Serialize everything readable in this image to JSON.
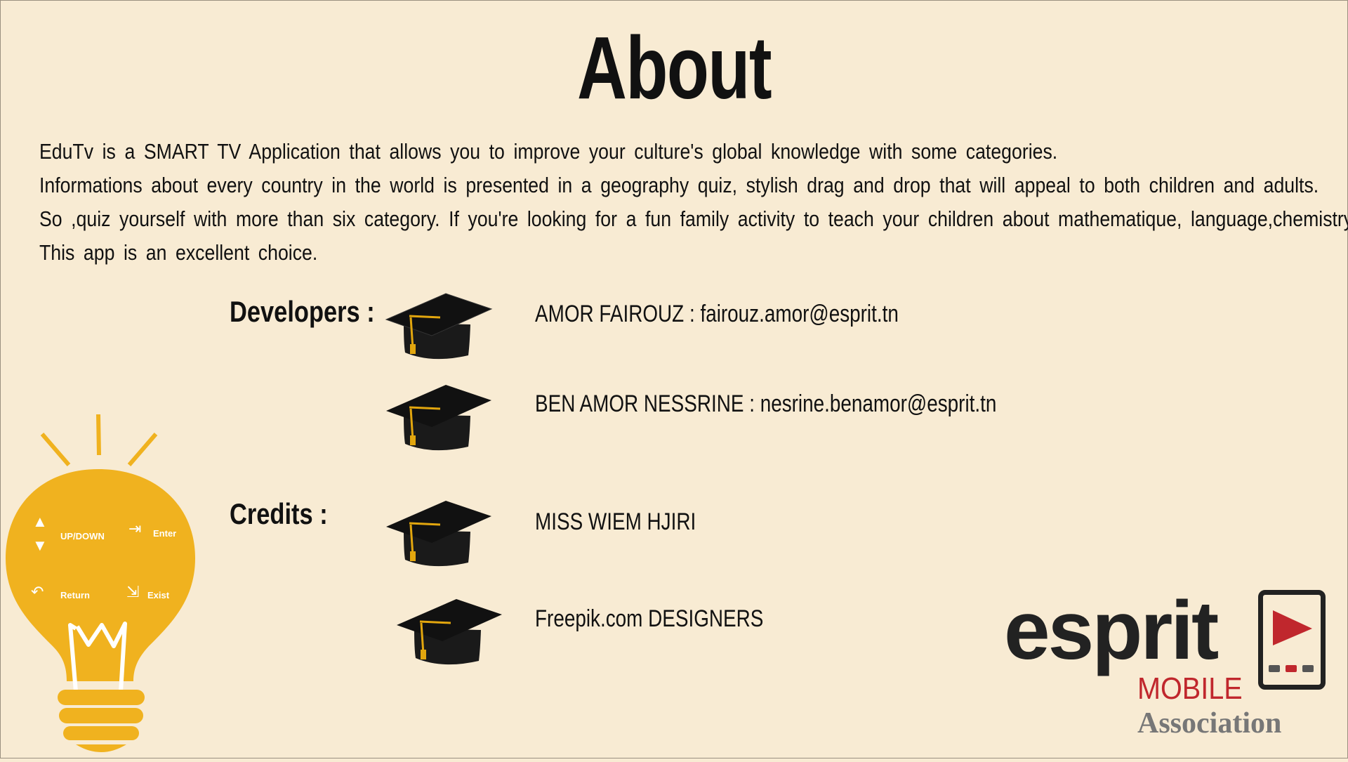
{
  "page": {
    "title": "About",
    "description": [
      "EduTv is a SMART TV Application that allows you to improve your culture's global knowledge with some categories.",
      "Informations about every country in the world is presented in a geography quiz, stylish drag and drop that will appeal to both children and adults.",
      "So ,quiz yourself with more than six category. If you're looking for a fun family activity to teach your children about mathematique, language,chemistry ...",
      "This app is an excellent choice."
    ]
  },
  "developers": {
    "label": "Developers :",
    "entries": [
      "AMOR  FAIROUZ : fairouz.amor@esprit.tn",
      "BEN  AMOR  NESSRINE  :   nesrine.benamor@esprit.tn"
    ]
  },
  "credits": {
    "label": "Credits :",
    "entries": [
      "MISS  WIEM  HJIRI",
      "Freepik.com  DESIGNERS"
    ]
  },
  "remote_help": {
    "updown": "UP/DOWN",
    "enter": "Enter",
    "return": "Return",
    "exist": "Exist"
  },
  "logo": {
    "esprit": "esprit",
    "mobile": "MOBILE",
    "association": "Association"
  },
  "icons": [
    "graduation-cap-icon",
    "light-bulb-icon",
    "arrow-up-icon",
    "arrow-down-icon",
    "enter-icon",
    "return-icon",
    "exit-icon",
    "phone-play-icon"
  ],
  "colors": {
    "background": "#f8ebd3",
    "bulb": "#f0b21f",
    "cap": "#1a1a1a",
    "tassel": "#e2a60e",
    "mobile_red": "#c0272d",
    "association_gray": "#777777"
  }
}
